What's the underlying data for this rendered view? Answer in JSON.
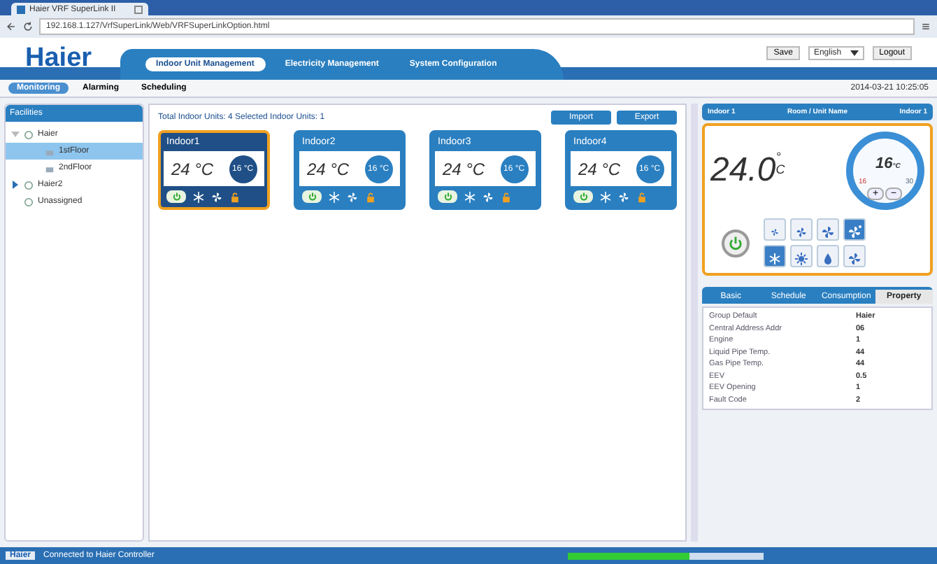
{
  "browser": {
    "tab_title": "Haier VRF SuperLink II",
    "url": "192.168.1.127/VrfSuperLink/Web/VRFSuperLinkOption.html"
  },
  "header": {
    "logo": "Haier",
    "nav": [
      {
        "label": "Indoor Unit Management",
        "selected": true
      },
      {
        "label": "Electricity Management",
        "selected": false
      },
      {
        "label": "System Configuration",
        "selected": false
      }
    ],
    "save": "Save",
    "language": "English",
    "logout": "Logout"
  },
  "subtabs": [
    {
      "label": "Monitoring",
      "selected": true
    },
    {
      "label": "Alarming",
      "selected": false
    },
    {
      "label": "Scheduling",
      "selected": false
    }
  ],
  "datetime": "2014-03-21 10:25:05",
  "sidebar": {
    "title": "Facilities",
    "tree": [
      {
        "label": "Haier",
        "expanded": true,
        "selected": false,
        "children": [
          {
            "label": "1stFloor",
            "selected": true
          },
          {
            "label": "2ndFloor",
            "selected": false
          }
        ]
      },
      {
        "label": "Haier2",
        "expanded": false,
        "selected": false
      },
      {
        "label": "Unassigned",
        "selected": false
      }
    ]
  },
  "summary": "Total Indoor Units: 4   Selected Indoor Units: 1",
  "buttons": [
    "Import",
    "Export"
  ],
  "units": [
    {
      "name": "Indoor1",
      "temp": "24 °C",
      "setpoint": "16 °C",
      "selected": true
    },
    {
      "name": "Indoor2",
      "temp": "24 °C",
      "setpoint": "16 °C",
      "selected": false
    },
    {
      "name": "Indoor3",
      "temp": "24 °C",
      "setpoint": "16 °C",
      "selected": false
    },
    {
      "name": "Indoor4",
      "temp": "24 °C",
      "setpoint": "16 °C",
      "selected": false
    }
  ],
  "detail": {
    "left": "Indoor 1",
    "center": "Room / Unit Name",
    "right": "Indoor 1",
    "temp": "24.0",
    "degree": "°",
    "unit": "C",
    "dial_value": "16",
    "dial_unit": "°C",
    "dial_min": "16",
    "dial_max": "30",
    "plus": "+",
    "minus": "−",
    "fan": [
      {
        "kind": "low",
        "selected": false
      },
      {
        "kind": "mid",
        "selected": false
      },
      {
        "kind": "high",
        "selected": false
      },
      {
        "kind": "auto",
        "selected": true
      }
    ],
    "modes": [
      {
        "kind": "cool",
        "selected": true
      },
      {
        "kind": "heat",
        "selected": false
      },
      {
        "kind": "dry",
        "selected": false
      },
      {
        "kind": "fan",
        "selected": false
      }
    ],
    "tabs": [
      {
        "label": "Basic",
        "selected": false
      },
      {
        "label": "Schedule",
        "selected": false
      },
      {
        "label": "Consumption",
        "selected": false
      },
      {
        "label": "Property",
        "selected": true
      }
    ],
    "properties": [
      {
        "name": "Group Default",
        "value": "Haier"
      },
      {
        "name": "Central Address Addr",
        "value": "06"
      },
      {
        "name": "Engine",
        "value": "1"
      },
      {
        "name": "Liquid Pipe Temp.",
        "value": "44"
      },
      {
        "name": "Gas Pipe Temp.",
        "value": "44"
      },
      {
        "name": "EEV",
        "value": "0.5"
      },
      {
        "name": "EEV Opening",
        "value": "1"
      },
      {
        "name": "Fault Code",
        "value": "2"
      }
    ]
  },
  "status": {
    "brand": "Haier",
    "message": "Connected to Haier Controller",
    "progress": {
      "level": 0.62
    }
  }
}
